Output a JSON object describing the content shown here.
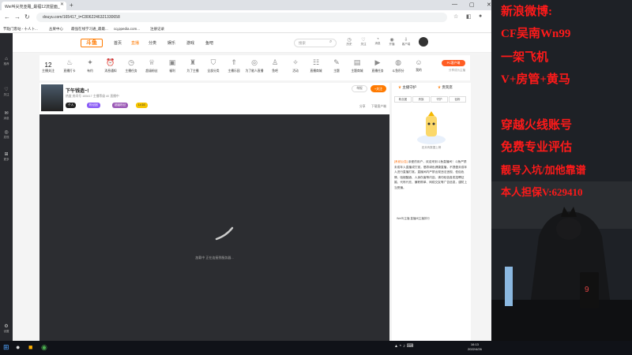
{
  "browser": {
    "tab_title": "Wei叫尖兜亚羅_最福12流屋面_",
    "url": "douyu.com/165417_t=C8062246321330658",
    "bookmarks": [
      "节點门客站 - 十人卜...",
      "丛果中心",
      "最强在线学习通_最最...",
      "cq.ppedia.com...",
      "注册记录"
    ]
  },
  "nav": {
    "logo": "斗鱼",
    "items": [
      "首页",
      "直播",
      "分类",
      "娱乐",
      "游戏",
      "鱼吧"
    ],
    "search_placeholder": "搜索",
    "icons": [
      {
        "label": "历史",
        "icon": "clock-icon"
      },
      {
        "label": "关注",
        "icon": "heart-icon"
      },
      {
        "label": "消息",
        "icon": "bell-icon"
      },
      {
        "label": "开播",
        "icon": "broadcast-icon"
      },
      {
        "label": "客户端",
        "icon": "download-icon"
      }
    ]
  },
  "sidebar": [
    {
      "label": "推荐",
      "icon": "home-icon"
    },
    {
      "label": "关注",
      "icon": "heart-icon"
    },
    {
      "label": "消息",
      "icon": "message-icon"
    },
    {
      "label": "发现",
      "icon": "globe-icon"
    },
    {
      "label": "更多",
      "icon": "grid-icon"
    }
  ],
  "sidebar_bottom": "设置",
  "category_bar": {
    "favorites_count": "12",
    "favorites_label": "主播关注",
    "items": [
      {
        "label": "直播打卡",
        "icon": "flame-icon"
      },
      {
        "label": "有约",
        "icon": "star-icon"
      },
      {
        "label": "消息通知",
        "icon": "bell-icon"
      },
      {
        "label": "主播任务",
        "icon": "clock-icon"
      },
      {
        "label": "超级粉丝",
        "icon": "crown-icon"
      },
      {
        "label": "福利",
        "icon": "gift-icon"
      },
      {
        "label": "为了主播",
        "icon": "trophy-icon"
      },
      {
        "label": "全部分类",
        "icon": "shield-icon"
      },
      {
        "label": "主播乐园",
        "icon": "rocket-icon"
      },
      {
        "label": "为了能人直播",
        "icon": "globe-icon"
      },
      {
        "label": "鱼吧",
        "icon": "person-icon"
      },
      {
        "label": "活动",
        "icon": "compass-icon"
      },
      {
        "label": "直播商城",
        "icon": "chat-icon"
      },
      {
        "label": "主题",
        "icon": "edit-icon"
      },
      {
        "label": "主题商城",
        "icon": "bag-icon"
      },
      {
        "label": "直播任务",
        "icon": "video-icon"
      },
      {
        "label": "斗鱼积分",
        "icon": "coin-icon"
      },
      {
        "label": "我的",
        "icon": "user-icon"
      }
    ],
    "pc_button": "PC客户端",
    "pc_sub": "分享成为主播"
  },
  "streamer": {
    "name": "下午钱造~!",
    "room_line": "热度   房间号 165417   主播等级 40   直播中",
    "badges": [
      "个人",
      "粉丝团",
      "超级粉丝"
    ],
    "level": "Lv.16",
    "report": "举报",
    "follow": "+关注",
    "stats": [
      "分享",
      "下载客户端"
    ]
  },
  "player": {
    "loading_text": "加载中 正在连接到服务器..."
  },
  "right_panel": {
    "tabs": [
      "主播守护",
      "贵宾席"
    ],
    "subtabs": [
      "粉丝团",
      "贵族",
      "守护",
      "钻粉"
    ],
    "caption": "还未有数据上榜",
    "notice_tag": "[系统公告]",
    "notice_text": "亲爱的用户，欢迎来到斗鱼直播间！斗鱼严禁未成年人直播或打赏，倡导绿色健康直播，不提倡未成年人进行直播打赏。直播间内严禁出现违法违规、低俗色情、吸烟酗酒、人身伤害等内容。请勿轻信各类招聘征婚、代练代充、兼职刷单、网络交友等广告信息，谨防上当受骗。",
    "bottom": "Wei叫主播   直播间主播排行"
  },
  "overlay": {
    "lines": [
      "新浪微博:",
      "CF吴南Wn99",
      "一架飞机",
      "V+房管+黄马",
      "穿越火线账号",
      "免费专业评估",
      "靓号入坑/加他靠谱",
      "本人担保V:629410"
    ]
  },
  "taskbar": {
    "time": "16:13",
    "date": "2022/4/26"
  }
}
